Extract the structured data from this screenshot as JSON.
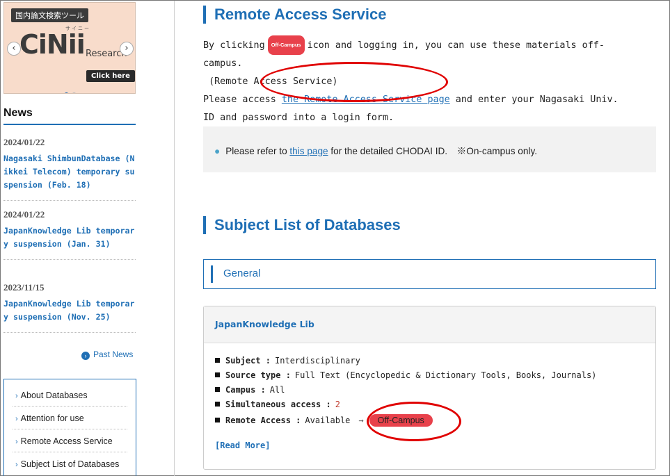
{
  "banner": {
    "tag": "国内論文検索ツール",
    "ruby": "サイニー",
    "logo": "CiNii",
    "sub": "Research",
    "click_label": "Click here",
    "prev_glyph": "‹",
    "next_glyph": "›"
  },
  "news": {
    "heading": "News",
    "items": [
      {
        "date": "2024/01/22",
        "title": "Nagasaki ShimbunDatabase (Nikkei Telecom) temporary suspension (Feb. 18)"
      },
      {
        "date": "2024/01/22",
        "title": "JapanKnowledge Lib temporary suspension (Jan. 31)"
      },
      {
        "date": "2023/11/15",
        "title": "JapanKnowledge Lib temporary suspension (Nov. 25)"
      }
    ],
    "past_label": "Past News"
  },
  "side_nav": {
    "items": [
      {
        "label": "About Databases"
      },
      {
        "label": "Attention for use"
      },
      {
        "label": "Remote Access Service"
      },
      {
        "label": "Subject List of Databases"
      }
    ]
  },
  "remote_access": {
    "heading": "Remote Access Service",
    "para1_before": "By clicking",
    "badge_small": "Off-Campus",
    "para1_after": "icon and logging in, you can use these materials off-campus.",
    "para1_line2": "(Remote Access Service)",
    "para2_before": "Please access",
    "para2_link": "the Remote Access Service page",
    "para2_after": "and enter your Nagasaki Univ. ID and password into a login form.",
    "note_before": "Please refer to",
    "note_link": "this page",
    "note_after": "for the detailed CHODAI ID.　※On-campus only."
  },
  "subjects": {
    "heading": "Subject List of Databases",
    "category": "General"
  },
  "db_card": {
    "title": "JapanKnowledge Lib",
    "rows": {
      "subject_key": "Subject :",
      "subject_val": "Interdisciplinary",
      "source_key": "Source type :",
      "source_val": "Full Text (Encyclopedic & Dictionary Tools, Books, Journals)",
      "campus_key": "Campus :",
      "campus_val": "All",
      "simul_key": "Simultaneous access :",
      "simul_val": "2",
      "remote_key": "Remote Access :",
      "remote_val": "Available",
      "remote_arrow": "→",
      "remote_badge": "Off-Campus"
    },
    "read_more": "[Read More]"
  },
  "colors": {
    "accent": "#1f6fb5",
    "badge": "#e8414b",
    "highlight_ring": "#e00000"
  }
}
